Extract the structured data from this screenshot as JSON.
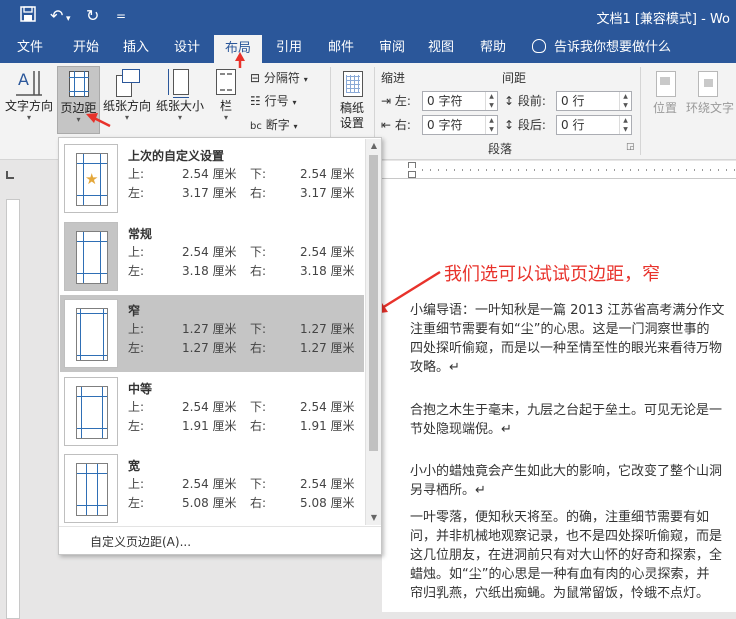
{
  "titlebar": {
    "save_icon": "save-icon",
    "undo": "↶",
    "redo": "↻",
    "customize": "=",
    "title": "文档1 [兼容模式] - Wo"
  },
  "tabs": [
    {
      "label": "文件"
    },
    {
      "label": "开始"
    },
    {
      "label": "插入"
    },
    {
      "label": "设计"
    },
    {
      "label": "布局"
    },
    {
      "label": "引用"
    },
    {
      "label": "邮件"
    },
    {
      "label": "审阅"
    },
    {
      "label": "视图"
    },
    {
      "label": "帮助"
    }
  ],
  "tellme": "告诉我你想要做什么",
  "ribbon": {
    "text_direction": "文字方向",
    "margins": "页边距",
    "orientation": "纸张方向",
    "size": "纸张大小",
    "columns": "栏",
    "breaks": "分隔符",
    "line_numbers": "行号",
    "hyphenation": "断字",
    "draft_line1": "稿纸",
    "draft_line2": "设置",
    "indent_title": "缩进",
    "spacing_title": "间距",
    "indent_left_label": "左:",
    "indent_left_value": "0 字符",
    "indent_right_label": "右:",
    "indent_right_value": "0 字符",
    "space_before_label": "段前:",
    "space_before_value": "0 行",
    "space_after_label": "段后:",
    "space_after_value": "0 行",
    "paragraph_group": "段落",
    "position": "位置",
    "wrap_text": "环绕文字"
  },
  "gallery": {
    "items": [
      {
        "name": "上次的自定义设置",
        "top": "2.54 厘米",
        "bottom": "2.54 厘米",
        "left": "3.17 厘米",
        "right": "3.17 厘米"
      },
      {
        "name": "常规",
        "top": "2.54 厘米",
        "bottom": "2.54 厘米",
        "left": "3.18 厘米",
        "right": "3.18 厘米"
      },
      {
        "name": "窄",
        "top": "1.27 厘米",
        "bottom": "1.27 厘米",
        "left": "1.27 厘米",
        "right": "1.27 厘米"
      },
      {
        "name": "中等",
        "top": "2.54 厘米",
        "bottom": "2.54 厘米",
        "left": "1.91 厘米",
        "right": "1.91 厘米"
      },
      {
        "name": "宽",
        "top": "2.54 厘米",
        "bottom": "2.54 厘米",
        "left": "5.08 厘米",
        "right": "5.08 厘米"
      }
    ],
    "labels": {
      "top": "上:",
      "bottom": "下:",
      "left": "左:",
      "right": "右:"
    },
    "custom": "自定义页边距(A)..."
  },
  "annotation": "我们选可以试试页边距，窄",
  "document": {
    "lines": [
      "小编导语：一叶知秋是一篇 2013 江苏省高考满分作文",
      "注重细节需要有如“尘”的心思。这是一门洞察世事的",
      "四处探听偷窥，而是以一种至情至性的眼光来看待万物",
      "攻略。↵",
      "合抱之木生于毫末，九层之台起于垒土。可见无论是一",
      "节处隐现端倪。↵",
      "小小的蜡烛竟会产生如此大的影响，它改变了整个山洞",
      "另寻栖所。↵",
      "一叶零落，便知秋天将至。的确，注重细节需要有如",
      "问，并非机械地观察记录，也不是四处探听偷窥，而是",
      "这几位朋友，在进洞前只有对大山怀的好奇和探索，全",
      "蜡烛。如“尘”的心思是一种有血有肉的心灵探索，并",
      "帘归乳燕，穴纸出痴蝇。为鼠常留饭，怜蛾不点灯。"
    ]
  },
  "colors": {
    "titlebar": "#2b579a",
    "ribbon": "#f3f3f3",
    "selected_item": "#c5c5c5",
    "annotation": "#e8322b"
  }
}
